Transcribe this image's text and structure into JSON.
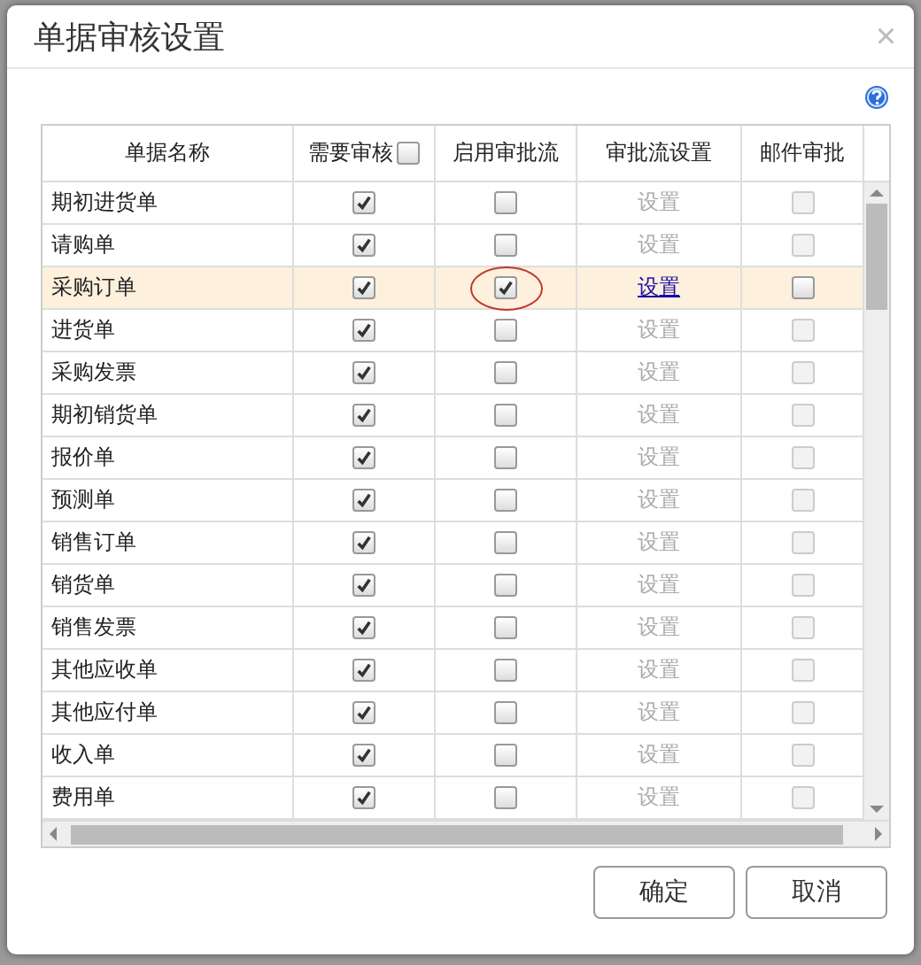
{
  "dialog": {
    "title": "单据审核设置",
    "close": "×"
  },
  "table": {
    "columns": [
      "单据名称",
      "需要审核",
      "启用审批流",
      "审批流设置",
      "邮件审批"
    ],
    "review_all": false,
    "rows": [
      {
        "name": "期初进货单",
        "review": true,
        "workflow": false,
        "setting": "设置",
        "setting_enabled": false,
        "email": false,
        "email_disabled": true,
        "selected": false,
        "circled": false
      },
      {
        "name": "请购单",
        "review": true,
        "workflow": false,
        "setting": "设置",
        "setting_enabled": false,
        "email": false,
        "email_disabled": true,
        "selected": false,
        "circled": false
      },
      {
        "name": "采购订单",
        "review": true,
        "workflow": true,
        "setting": "设置",
        "setting_enabled": true,
        "email": false,
        "email_disabled": false,
        "selected": true,
        "circled": true
      },
      {
        "name": "进货单",
        "review": true,
        "workflow": false,
        "setting": "设置",
        "setting_enabled": false,
        "email": false,
        "email_disabled": true,
        "selected": false,
        "circled": false
      },
      {
        "name": "采购发票",
        "review": true,
        "workflow": false,
        "setting": "设置",
        "setting_enabled": false,
        "email": false,
        "email_disabled": true,
        "selected": false,
        "circled": false
      },
      {
        "name": "期初销货单",
        "review": true,
        "workflow": false,
        "setting": "设置",
        "setting_enabled": false,
        "email": false,
        "email_disabled": true,
        "selected": false,
        "circled": false
      },
      {
        "name": "报价单",
        "review": true,
        "workflow": false,
        "setting": "设置",
        "setting_enabled": false,
        "email": false,
        "email_disabled": true,
        "selected": false,
        "circled": false
      },
      {
        "name": "预测单",
        "review": true,
        "workflow": false,
        "setting": "设置",
        "setting_enabled": false,
        "email": false,
        "email_disabled": true,
        "selected": false,
        "circled": false
      },
      {
        "name": "销售订单",
        "review": true,
        "workflow": false,
        "setting": "设置",
        "setting_enabled": false,
        "email": false,
        "email_disabled": true,
        "selected": false,
        "circled": false
      },
      {
        "name": "销货单",
        "review": true,
        "workflow": false,
        "setting": "设置",
        "setting_enabled": false,
        "email": false,
        "email_disabled": true,
        "selected": false,
        "circled": false
      },
      {
        "name": "销售发票",
        "review": true,
        "workflow": false,
        "setting": "设置",
        "setting_enabled": false,
        "email": false,
        "email_disabled": true,
        "selected": false,
        "circled": false
      },
      {
        "name": "其他应收单",
        "review": true,
        "workflow": false,
        "setting": "设置",
        "setting_enabled": false,
        "email": false,
        "email_disabled": true,
        "selected": false,
        "circled": false
      },
      {
        "name": "其他应付单",
        "review": true,
        "workflow": false,
        "setting": "设置",
        "setting_enabled": false,
        "email": false,
        "email_disabled": true,
        "selected": false,
        "circled": false
      },
      {
        "name": "收入单",
        "review": true,
        "workflow": false,
        "setting": "设置",
        "setting_enabled": false,
        "email": false,
        "email_disabled": true,
        "selected": false,
        "circled": false
      },
      {
        "name": "费用单",
        "review": true,
        "workflow": false,
        "setting": "设置",
        "setting_enabled": false,
        "email": false,
        "email_disabled": true,
        "selected": false,
        "circled": false
      }
    ]
  },
  "buttons": [
    "确定",
    "取消"
  ]
}
